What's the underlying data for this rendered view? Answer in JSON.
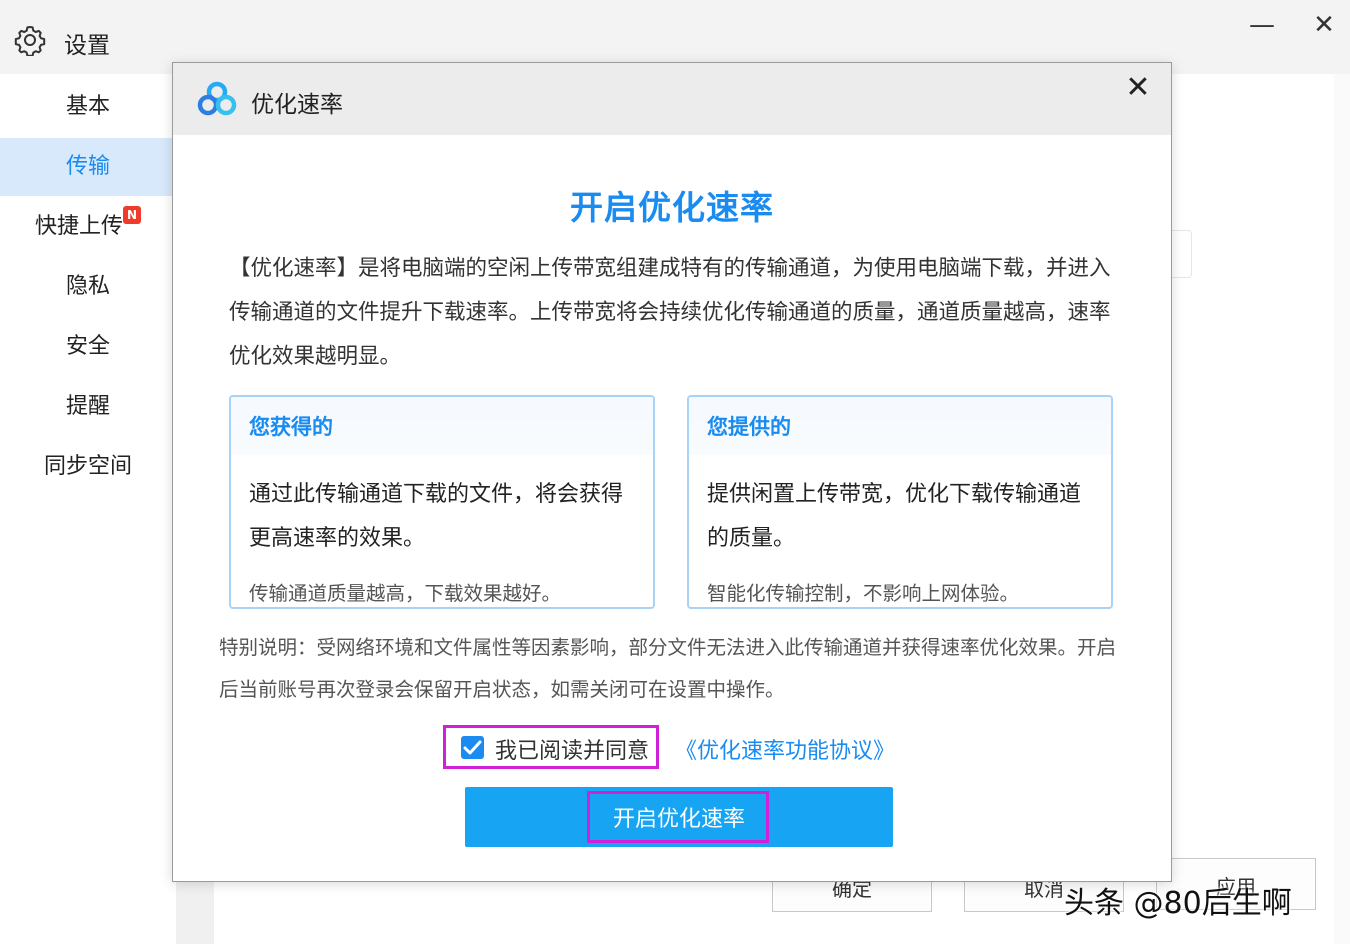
{
  "settings": {
    "title": "设置",
    "window_controls": {
      "minimize": "—",
      "close": "✕"
    },
    "sidebar": {
      "items": [
        {
          "label": "基本"
        },
        {
          "label": "传输"
        },
        {
          "label": "快捷上传",
          "badge": "N"
        },
        {
          "label": "隐私"
        },
        {
          "label": "安全"
        },
        {
          "label": "提醒"
        },
        {
          "label": "同步空间"
        }
      ],
      "active_index": 1
    },
    "footer": {
      "ok_label": "确定",
      "cancel_label": "取消",
      "apply_label": "应用"
    }
  },
  "dialog": {
    "title": "优化速率",
    "close": "✕",
    "headline": "开启优化速率",
    "intro": "【优化速率】是将电脑端的空闲上传带宽组建成特有的传输通道，为使用电脑端下载，并进入传输通道的文件提升下载速率。上传带宽将会持续优化传输通道的质量，通道质量越高，速率优化效果越明显。",
    "cards": [
      {
        "title": "您获得的",
        "body": "通过此传输通道下载的文件，将会获得更高速率的效果。",
        "note": "传输通道质量越高，下载效果越好。"
      },
      {
        "title": "您提供的",
        "body": "提供闲置上传带宽，优化下载传输通道的质量。",
        "note": "智能化传输控制，不影响上网体验。"
      }
    ],
    "special_note": "特别说明：受网络环境和文件属性等因素影响，部分文件无法进入此传输通道并获得速率优化效果。开启后当前账号再次登录会保留开启状态，如需关闭可在设置中操作。",
    "agree": {
      "checked": true,
      "label": "我已阅读并同意",
      "link": "《优化速率功能协议》"
    },
    "primary_button": "开启优化速率"
  },
  "watermark": "头条 @80后生啊",
  "colors": {
    "accent": "#1a8bf0",
    "button": "#17a4f2",
    "highlight_frame": "#d020d8",
    "badge": "#ee3b2b"
  }
}
